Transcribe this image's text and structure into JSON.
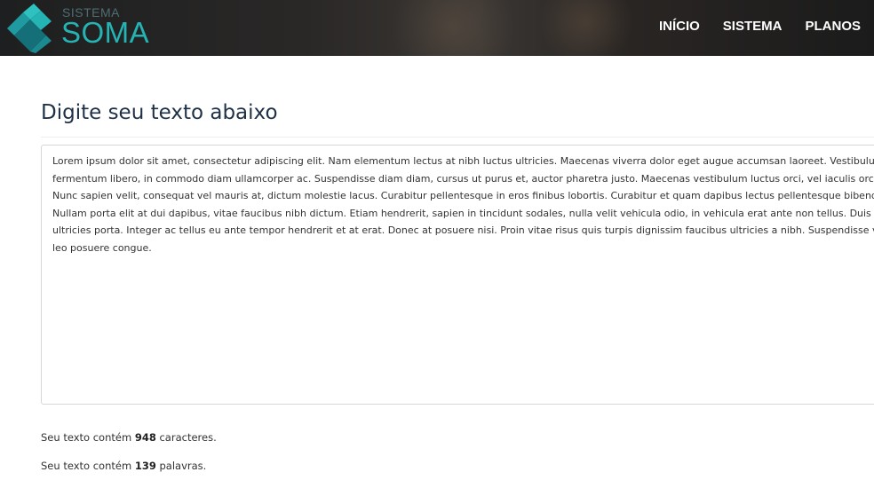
{
  "header": {
    "brand_small": "SISTEMA",
    "brand_big": "SOMA",
    "logo_icon": "soma-logo-icon",
    "nav": [
      {
        "label": "INÍCIO"
      },
      {
        "label": "SISTEMA"
      },
      {
        "label": "PLANOS"
      }
    ]
  },
  "main": {
    "title": "Digite seu texto abaixo",
    "textarea_lines": [
      "Lorem ipsum dolor sit amet, consectetur adipiscing elit. Nam elementum lectus at nibh luctus ultricies. Maecenas viverra dolor eget augue accumsan laoreet. Vestibulum",
      "fermentum libero, in commodo diam ullamcorper ac. Suspendisse diam diam, cursus ut purus et, auctor pharetra justo. Maecenas vestibulum luctus orci, vel iaculis orci d",
      "Nunc sapien velit, consequat vel mauris at, dictum molestie lacus. Curabitur pellentesque in eros finibus lobortis. Curabitur et quam dapibus lectus pellentesque bibendu",
      "Nullam porta elit at dui dapibus, vitae faucibus nibh dictum. Etiam hendrerit, sapien in tincidunt sodales, nulla velit vehicula odio, in vehicula erat ante non tellus. Duis v",
      "ultricies porta. Integer ac tellus eu ante tempor hendrerit et at erat. Donec at posuere nisi. Proin vitae risus quis turpis dignissim faucibus ultricies a nibh. Suspendisse ve",
      "leo posuere congue."
    ],
    "stats": {
      "chars_prefix": "Seu texto contém",
      "chars_count": "948",
      "chars_suffix": "caracteres.",
      "words_prefix": "Seu texto contém",
      "words_count": "139",
      "words_suffix": "palavras."
    }
  },
  "colors": {
    "brand_teal": "#25b4b4",
    "brand_dark_teal": "#1a7f86",
    "title": "#1f3147",
    "header_bg": "#222222"
  }
}
